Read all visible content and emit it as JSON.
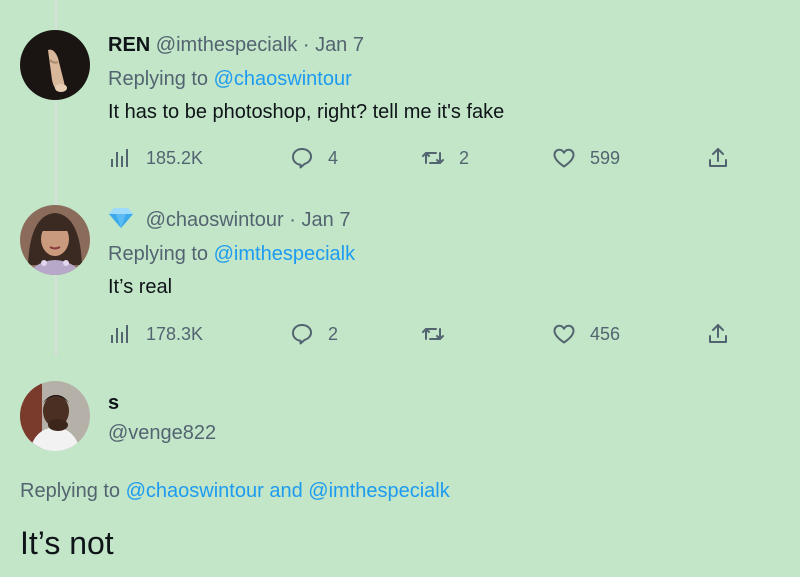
{
  "tweets": [
    {
      "name": "REN",
      "handle": "@imthespecialk",
      "separator": "·",
      "date": "Jan 7",
      "replying_prefix": "Replying to",
      "replying_to": "@chaoswintour",
      "text": "It has to be photoshop, right? tell me it's fake",
      "views": "185.2K",
      "replies": "4",
      "retweets": "2",
      "likes": "599"
    },
    {
      "badge_icon": "diamond-emoji",
      "handle": "@chaoswintour",
      "separator": "·",
      "date": "Jan 7",
      "replying_prefix": "Replying to",
      "replying_to": "@imthespecialk",
      "text": "It’s real",
      "views": "178.3K",
      "replies": "2",
      "retweets": "",
      "likes": "456"
    },
    {
      "name": "s",
      "handle": "@venge822",
      "replying_prefix": "Replying to",
      "replying_to_1": "@chaoswintour",
      "conjunction": "and",
      "replying_to_2": "@imthespecialk",
      "text": "It’s not"
    }
  ],
  "colors": {
    "background": "#c3e6c8",
    "link": "#1d9bf0",
    "muted": "#536471",
    "text": "#0f1419"
  }
}
